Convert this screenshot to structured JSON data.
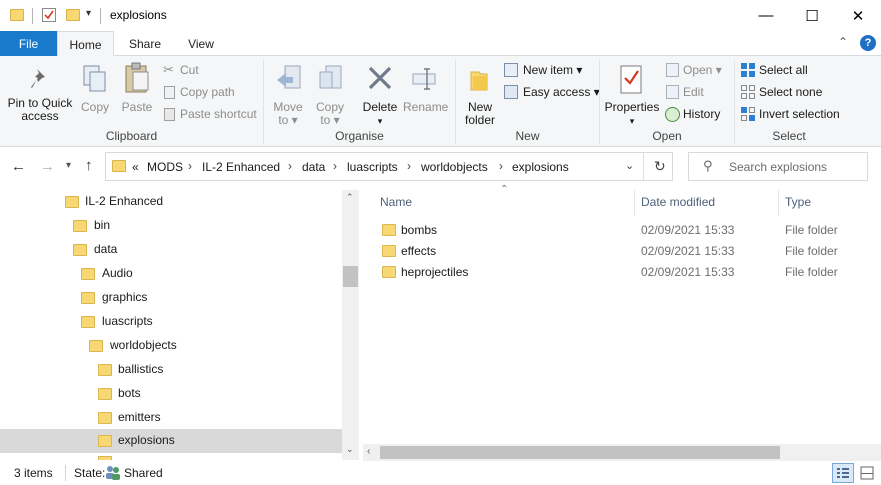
{
  "window": {
    "title": "explosions",
    "minimize": "—",
    "maximize": "☐",
    "close": "✕"
  },
  "tabs": {
    "file": "File",
    "home": "Home",
    "share": "Share",
    "view": "View"
  },
  "ribbon": {
    "clipboard": {
      "label": "Clipboard",
      "pin_line1": "Pin to Quick",
      "pin_line2": "access",
      "copy": "Copy",
      "paste": "Paste",
      "cut": "Cut",
      "copy_path": "Copy path",
      "paste_shortcut": "Paste shortcut"
    },
    "organise": {
      "label": "Organise",
      "move_to": "Move",
      "move_to2": "to ▾",
      "copy_to": "Copy",
      "copy_to2": "to ▾",
      "delete": "Delete",
      "delete2": "▾",
      "rename": "Rename"
    },
    "new": {
      "label": "New",
      "new_folder1": "New",
      "new_folder2": "folder",
      "new_item": "New item ▾",
      "easy_access": "Easy access ▾"
    },
    "open": {
      "label": "Open",
      "properties": "Properties",
      "properties2": "▾",
      "open": "Open ▾",
      "edit": "Edit",
      "history": "History"
    },
    "select": {
      "label": "Select",
      "select_all": "Select all",
      "select_none": "Select none",
      "invert": "Invert selection"
    }
  },
  "address": {
    "overflow": "«",
    "crumbs": [
      "MODS",
      "IL-2 Enhanced",
      "data",
      "luascripts",
      "worldobjects",
      "explosions"
    ],
    "separator": "›",
    "search_placeholder": "Search explosions"
  },
  "nav": {
    "items": [
      {
        "label": "IL-2 Enhanced",
        "level": 0,
        "selected": false
      },
      {
        "label": "bin",
        "level": 1,
        "selected": false
      },
      {
        "label": "data",
        "level": 1,
        "selected": false
      },
      {
        "label": "Audio",
        "level": 2,
        "selected": false
      },
      {
        "label": "graphics",
        "level": 2,
        "selected": false
      },
      {
        "label": "luascripts",
        "level": 2,
        "selected": false
      },
      {
        "label": "worldobjects",
        "level": 3,
        "selected": false
      },
      {
        "label": "ballistics",
        "level": 4,
        "selected": false
      },
      {
        "label": "bots",
        "level": 4,
        "selected": false
      },
      {
        "label": "emitters",
        "level": 4,
        "selected": false
      },
      {
        "label": "explosions",
        "level": 4,
        "selected": true
      }
    ]
  },
  "files": {
    "columns": {
      "name": "Name",
      "date": "Date modified",
      "type": "Type"
    },
    "rows": [
      {
        "name": "bombs",
        "date": "02/09/2021 15:33",
        "type": "File folder"
      },
      {
        "name": "effects",
        "date": "02/09/2021 15:33",
        "type": "File folder"
      },
      {
        "name": "heprojectiles",
        "date": "02/09/2021 15:33",
        "type": "File folder"
      }
    ]
  },
  "status": {
    "count": "3 items",
    "state_label": "State:",
    "state_value": "Shared"
  },
  "colors": {
    "accent": "#1979ca",
    "folder": "#f8d775",
    "selection": "#d9d9d9"
  }
}
